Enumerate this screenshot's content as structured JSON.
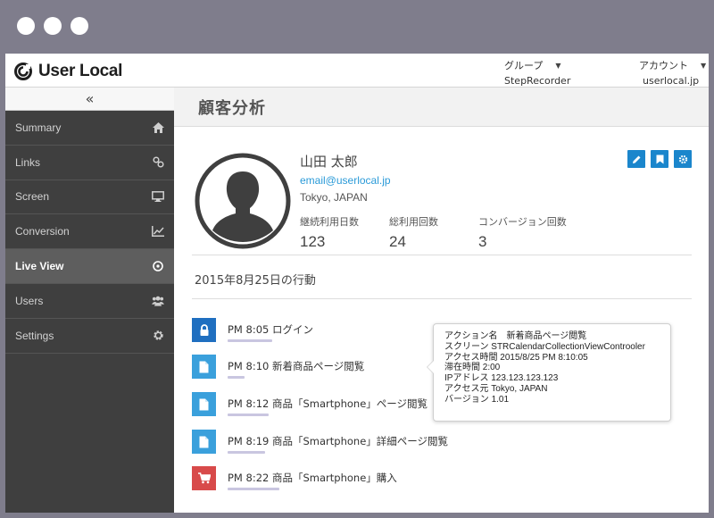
{
  "app": {
    "logo_text": "User Local"
  },
  "header": {
    "group": {
      "label": "グループ",
      "value": "StepRecorder"
    },
    "account": {
      "label": "アカウント",
      "value": "userlocal.jp"
    }
  },
  "sidebar": {
    "collapse_glyph": "«",
    "items": [
      {
        "label": "Summary",
        "icon": "home-icon"
      },
      {
        "label": "Links",
        "icon": "link-icon"
      },
      {
        "label": "Screen",
        "icon": "monitor-icon"
      },
      {
        "label": "Conversion",
        "icon": "chart-icon"
      },
      {
        "label": "Live View",
        "icon": "clock-icon",
        "active": true
      },
      {
        "label": "Users",
        "icon": "users-icon"
      },
      {
        "label": "Settings",
        "icon": "gear-icon"
      }
    ]
  },
  "main": {
    "title": "顧客分析",
    "profile": {
      "name": "山田 太郎",
      "email": "email@userlocal.jp",
      "location": "Tokyo, JAPAN",
      "stats": [
        {
          "label": "継続利用日数",
          "value": "123"
        },
        {
          "label": "総利用回数",
          "value": "24"
        },
        {
          "label": "コンバージョン回数",
          "value": "3"
        }
      ]
    },
    "section_title": "2015年8月25日の行動",
    "events": [
      {
        "text": "PM 8:05 ログイン",
        "icon": "lock-icon",
        "color": "#1f6fc0"
      },
      {
        "text": "PM 8:10 新着商品ページ閲覧",
        "icon": "page-icon",
        "color": "#3aa0dc"
      },
      {
        "text": "PM 8:12 商品「Smartphone」ページ閲覧",
        "icon": "page-icon",
        "color": "#3aa0dc"
      },
      {
        "text": "PM 8:19 商品「Smartphone」詳細ページ閲覧",
        "icon": "page-icon",
        "color": "#3aa0dc"
      },
      {
        "text": "PM 8:22 商品「Smartphone」購入",
        "icon": "cart-icon",
        "color": "#d84a4a"
      }
    ],
    "tooltip": {
      "lines": [
        "アクション名　新着商品ページ閲覧",
        "スクリーン STRCalendarCollectionViewControoler",
        "アクセス時間 2015/8/25 PM 8:10:05",
        "滞在時間 2:00",
        "IPアドレス 123.123.123.123",
        "アクセス元 Tokyo, JAPAN",
        "バージョン 1.01"
      ]
    }
  },
  "colors": {
    "accent": "#1b86cc",
    "sidebar_bg": "#3f3f3f",
    "sidebar_active": "#5e5e5e",
    "purchase": "#d84a4a"
  }
}
